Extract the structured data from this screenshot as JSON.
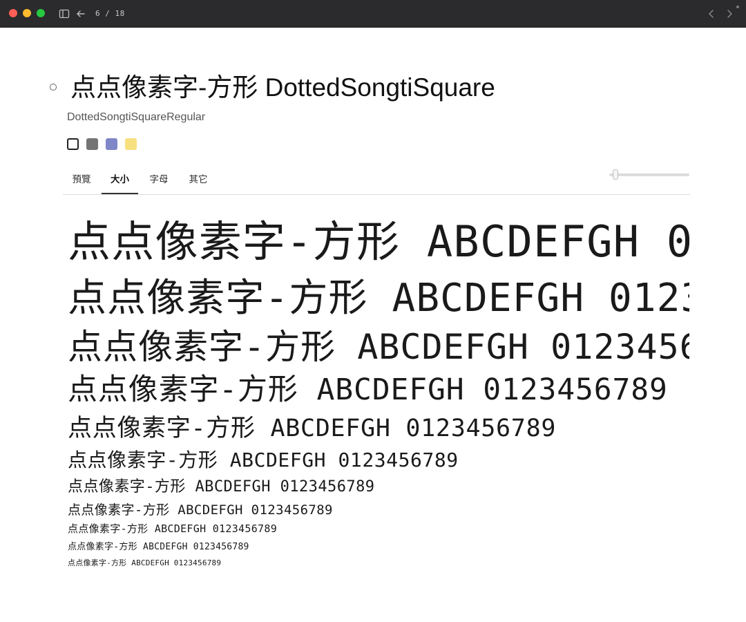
{
  "window": {
    "page_counter": "6 / 18",
    "icons": [
      "sidebar-toggle-icon",
      "back-arrow-icon",
      "chevron-left-icon",
      "chevron-right-icon"
    ]
  },
  "font": {
    "title": "点点像素字-方形 DottedSongtiSquare",
    "subtitle": "DottedSongtiSquareRegular"
  },
  "swatches": [
    {
      "name": "white",
      "color": "#ffffff"
    },
    {
      "name": "gray",
      "color": "#747474"
    },
    {
      "name": "periwinkle",
      "color": "#7f87c8"
    },
    {
      "name": "yellow",
      "color": "#f7e07f"
    }
  ],
  "tabs": [
    {
      "label": "預覽",
      "active": false
    },
    {
      "label": "大小",
      "active": true
    },
    {
      "label": "字母",
      "active": false
    },
    {
      "label": "其它",
      "active": false
    }
  ],
  "size_slider": {
    "value": 0.05
  },
  "samples": {
    "text": "点点像素字-方形 ABCDEFGH 0123456789"
  },
  "colors": {
    "titlebar": "#2b2b2d",
    "accent_underline": "#333333",
    "divider": "#dcdcdc"
  }
}
